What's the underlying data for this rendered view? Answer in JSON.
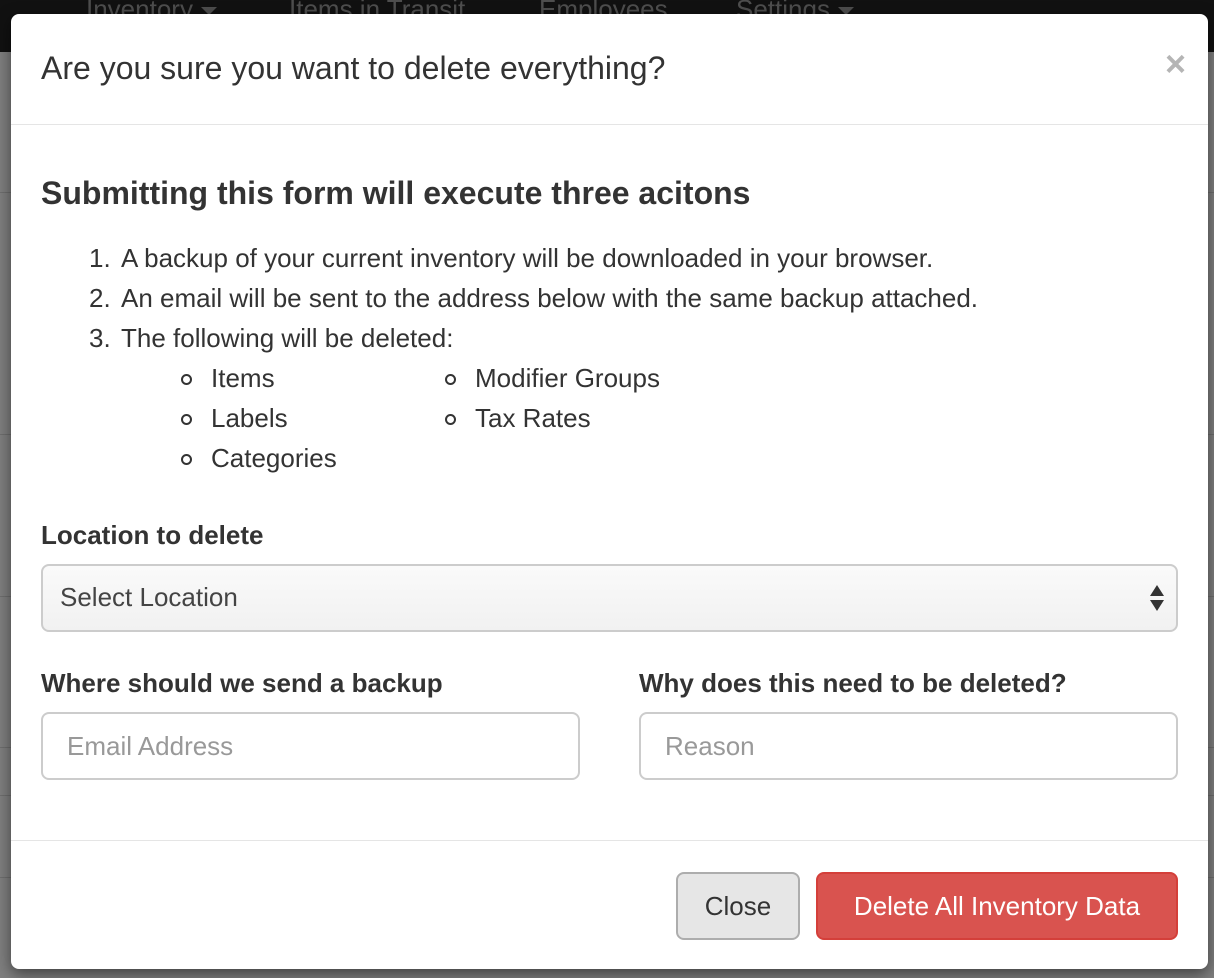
{
  "background": {
    "nav_items": [
      {
        "label": "Inventory",
        "has_caret": true
      },
      {
        "label": "Items in Transit",
        "has_caret": false
      },
      {
        "label": "Employees",
        "has_caret": false
      },
      {
        "label": "Settings",
        "has_caret": true
      }
    ]
  },
  "modal": {
    "title": "Are you sure you want to delete everything?",
    "close_icon": "×",
    "heading": "Submitting this form will execute three acitons",
    "actions": [
      {
        "num": "1.",
        "text": "A backup of your current inventory will be downloaded in your browser."
      },
      {
        "num": "2.",
        "text": "An email will be sent to the address below with the same backup attached."
      },
      {
        "num": "3.",
        "text": "The following will be deleted:"
      }
    ],
    "deleted_items_col1": [
      "Items",
      "Labels",
      "Categories"
    ],
    "deleted_items_col2": [
      "Modifier Groups",
      "Tax Rates"
    ],
    "location": {
      "label": "Location to delete",
      "selected": "Select Location"
    },
    "backup": {
      "label": "Where should we send a backup",
      "placeholder": "Email Address",
      "value": ""
    },
    "reason": {
      "label": "Why does this need to be deleted?",
      "placeholder": "Reason",
      "value": ""
    },
    "buttons": {
      "close": "Close",
      "delete": "Delete All Inventory Data"
    }
  },
  "colors": {
    "danger": "#d9534f",
    "navbar": "#222222",
    "default_button": "#e6e6e6"
  }
}
